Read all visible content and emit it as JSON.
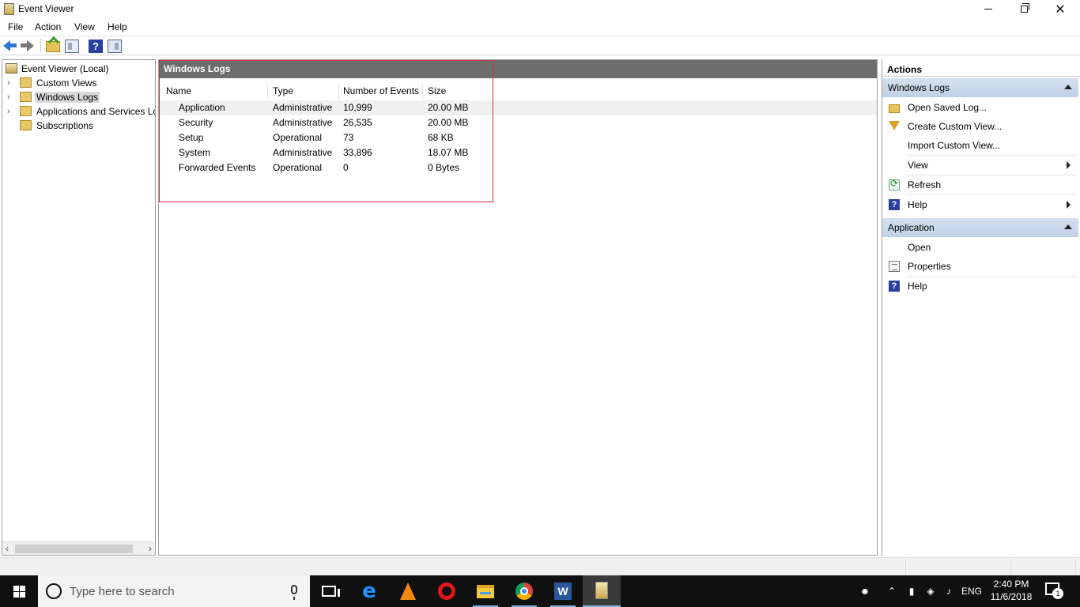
{
  "window": {
    "title": "Event Viewer",
    "controls": {
      "minimize": "minimize",
      "restore": "restore",
      "close": "✕"
    }
  },
  "menu": [
    "File",
    "Action",
    "View",
    "Help"
  ],
  "toolbar": {
    "icons": [
      "back-arrow-icon",
      "forward-arrow-icon",
      "folder-up-icon",
      "show-hide-tree-icon",
      "help-icon",
      "show-hide-action-pane-icon"
    ],
    "help_glyph": "?"
  },
  "tree": {
    "items": [
      {
        "label": "Event Viewer (Local)",
        "expander": ""
      },
      {
        "label": "Custom Views",
        "expander": "›"
      },
      {
        "label": "Windows Logs",
        "expander": "›",
        "selected": true
      },
      {
        "label": "Applications and Services Logs",
        "expander": "›"
      },
      {
        "label": "Subscriptions",
        "expander": ""
      }
    ],
    "scroll_left": "‹",
    "scroll_right": "›"
  },
  "center": {
    "header": "Windows Logs",
    "columns": [
      "Name",
      "Type",
      "Number of Events",
      "Size"
    ],
    "rows": [
      {
        "name": "Application",
        "type": "Administrative",
        "events": "10,999",
        "size": "20.00 MB"
      },
      {
        "name": "Security",
        "type": "Administrative",
        "events": "26,535",
        "size": "20.00 MB"
      },
      {
        "name": "Setup",
        "type": "Operational",
        "events": "73",
        "size": "68 KB"
      },
      {
        "name": "System",
        "type": "Administrative",
        "events": "33,896",
        "size": "18.07 MB"
      },
      {
        "name": "Forwarded Events",
        "type": "Operational",
        "events": "0",
        "size": "0 Bytes"
      }
    ]
  },
  "actions": {
    "title": "Actions",
    "sections": [
      {
        "header": "Windows Logs",
        "items": [
          "Open Saved Log...",
          "Create Custom View...",
          "Import Custom View...",
          "View",
          "Refresh",
          "Help"
        ]
      },
      {
        "header": "Application",
        "items": [
          "Open",
          "Properties",
          "Help"
        ]
      }
    ],
    "help_glyph": "?"
  },
  "taskbar": {
    "search_placeholder": "Type here to search",
    "language": "ENG",
    "time": "2:40 PM",
    "date": "11/6/2018",
    "notification_count": "1",
    "edge_glyph": "e",
    "word_glyph": "W"
  },
  "colors": {
    "highlight_border": "#d0303a",
    "header_bg": "#6d6d6d",
    "section_bg": "#c9d7ea"
  }
}
